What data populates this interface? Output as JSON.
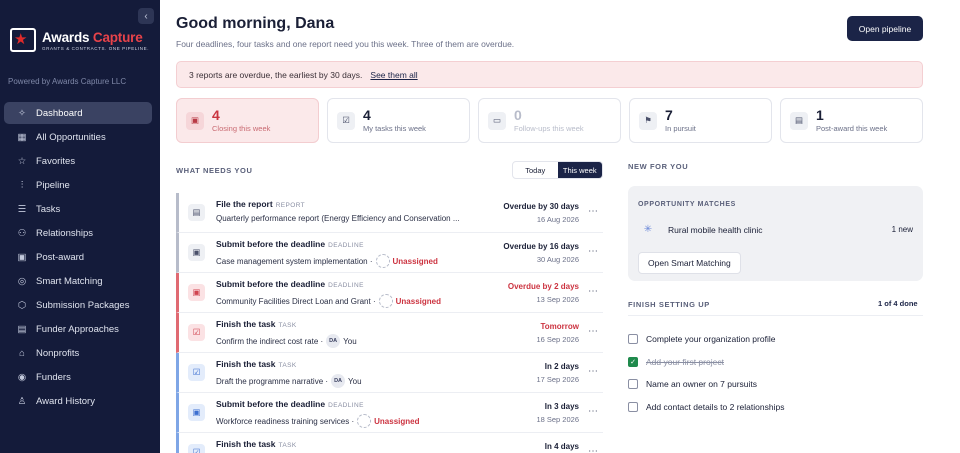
{
  "sidebar": {
    "collapse_icon": "chevron-left-icon",
    "logo": {
      "title_main": "Awards",
      "title_accent": "Capture",
      "tagline": "GRANTS & CONTRACTS. ONE PIPELINE."
    },
    "powered_by": "Powered by Awards Capture LLC",
    "items": [
      {
        "label": "Dashboard",
        "icon": "sparkle-icon",
        "glyph": "✧",
        "active": true
      },
      {
        "label": "All Opportunities",
        "icon": "grid-icon",
        "glyph": "▦",
        "active": false
      },
      {
        "label": "Favorites",
        "icon": "star-icon",
        "glyph": "☆",
        "active": false
      },
      {
        "label": "Pipeline",
        "icon": "pipeline-icon",
        "glyph": "⫶",
        "active": false
      },
      {
        "label": "Tasks",
        "icon": "tasks-icon",
        "glyph": "☰",
        "active": false
      },
      {
        "label": "Relationships",
        "icon": "people-icon",
        "glyph": "⚇",
        "active": false
      },
      {
        "label": "Post-award",
        "icon": "calendar-icon",
        "glyph": "▣",
        "active": false
      },
      {
        "label": "Smart Matching",
        "icon": "target-icon",
        "glyph": "◎",
        "active": false
      },
      {
        "label": "Submission Packages",
        "icon": "package-icon",
        "glyph": "⬡",
        "active": false
      },
      {
        "label": "Funder Approaches",
        "icon": "document-icon",
        "glyph": "▤",
        "active": false
      },
      {
        "label": "Nonprofits",
        "icon": "building-icon",
        "glyph": "⌂",
        "active": false
      },
      {
        "label": "Funders",
        "icon": "dollar-icon",
        "glyph": "◉",
        "active": false
      },
      {
        "label": "Award History",
        "icon": "award-icon",
        "glyph": "♙",
        "active": false
      }
    ]
  },
  "header": {
    "greeting": "Good morning, Dana",
    "subtitle": "Four deadlines, four tasks and one report need you this week. Three of them are overdue.",
    "open_pipeline_label": "Open pipeline"
  },
  "banner": {
    "text": "3 reports are overdue, the earliest by 30 days.",
    "link": "See them all"
  },
  "stats": [
    {
      "value": "4",
      "label": "Closing this week",
      "icon": "calendar-icon",
      "glyph": "▣",
      "style": "highlight"
    },
    {
      "value": "4",
      "label": "My tasks this week",
      "icon": "check-square-icon",
      "glyph": "☑",
      "style": "normal"
    },
    {
      "value": "0",
      "label": "Follow-ups this week",
      "icon": "message-icon",
      "glyph": "▭",
      "style": "muted"
    },
    {
      "value": "7",
      "label": "In pursuit",
      "icon": "flag-icon",
      "glyph": "⚑",
      "style": "normal"
    },
    {
      "value": "1",
      "label": "Post-award this week",
      "icon": "file-icon",
      "glyph": "▤",
      "style": "normal"
    }
  ],
  "what_needs_you": {
    "title": "WHAT NEEDS YOU",
    "toggle": {
      "today": "Today",
      "this_week": "This week",
      "selected": "this_week"
    },
    "tasks": [
      {
        "title": "File the report",
        "tag": "REPORT",
        "desc": "Quarterly performance report (Energy Efficiency and Conservation ...",
        "assignee": null,
        "status": "Overdue by 30 days",
        "date": "16 Aug 2026",
        "accent": "grey",
        "status_style": "normal",
        "icon": "file-icon",
        "glyph": "▤"
      },
      {
        "title": "Submit before the deadline",
        "tag": "DEADLINE",
        "desc": "Case management system implementation ·",
        "assignee": "Unassigned",
        "assignee_initials": "",
        "status": "Overdue by 16 days",
        "date": "30 Aug 2026",
        "accent": "grey",
        "status_style": "normal",
        "icon": "calendar-icon",
        "glyph": "▣"
      },
      {
        "title": "Submit before the deadline",
        "tag": "DEADLINE",
        "desc": "Community Facilities Direct Loan and Grant ·",
        "assignee": "Unassigned",
        "assignee_initials": "",
        "status": "Overdue by 2 days",
        "date": "13 Sep 2026",
        "accent": "red",
        "status_style": "overdue-red",
        "icon": "calendar-icon",
        "glyph": "▣"
      },
      {
        "title": "Finish the task",
        "tag": "TASK",
        "desc": "Confirm the indirect cost rate ·",
        "assignee": "You",
        "assignee_initials": "DA",
        "status": "Tomorrow",
        "date": "16 Sep 2026",
        "accent": "red",
        "status_style": "tomorrow",
        "icon": "check-square-icon",
        "glyph": "☑"
      },
      {
        "title": "Finish the task",
        "tag": "TASK",
        "desc": "Draft the programme narrative ·",
        "assignee": "You",
        "assignee_initials": "DA",
        "status": "In 2 days",
        "date": "17 Sep 2026",
        "accent": "blue",
        "status_style": "normal",
        "icon": "check-square-icon",
        "glyph": "☑"
      },
      {
        "title": "Submit before the deadline",
        "tag": "DEADLINE",
        "desc": "Workforce readiness training services ·",
        "assignee": "Unassigned",
        "assignee_initials": "",
        "status": "In 3 days",
        "date": "18 Sep 2026",
        "accent": "blue",
        "status_style": "normal",
        "icon": "calendar-icon",
        "glyph": "▣"
      },
      {
        "title": "Finish the task",
        "tag": "TASK",
        "desc": "",
        "assignee": null,
        "status": "In 4 days",
        "date": "",
        "accent": "blue",
        "status_style": "normal",
        "icon": "check-square-icon",
        "glyph": "☑"
      }
    ]
  },
  "new_for_you": {
    "title": "NEW FOR YOU",
    "matches_title": "OPPORTUNITY MATCHES",
    "match_name": "Rural mobile health clinic",
    "match_count": "1 new",
    "match_icon": "sparkle-icon",
    "button": "Open Smart Matching"
  },
  "finish_setup": {
    "title": "FINISH SETTING UP",
    "progress": "1 of 4 done",
    "items": [
      {
        "label": "Complete your organization profile",
        "done": false
      },
      {
        "label": "Add your first project",
        "done": true
      },
      {
        "label": "Name an owner on 7 pursuits",
        "done": false
      },
      {
        "label": "Add contact details to 2 relationships",
        "done": false
      }
    ]
  },
  "colors": {
    "sidebar_bg": "#141b3a",
    "primary": "#1b2447",
    "danger": "#cc3340",
    "success": "#1f8a4c"
  }
}
